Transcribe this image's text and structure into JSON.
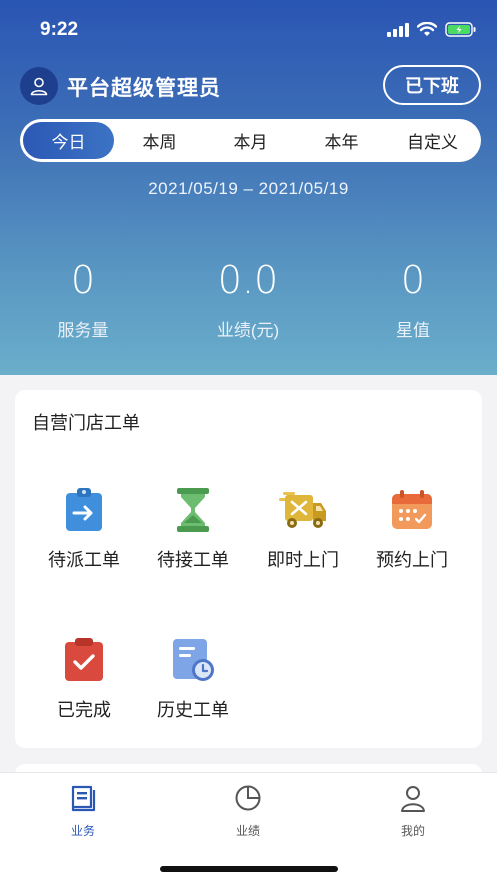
{
  "status": {
    "time": "9:22"
  },
  "header": {
    "admin_name": "平台超级管理员",
    "offduty_label": "已下班",
    "tabs": [
      "今日",
      "本周",
      "本月",
      "本年",
      "自定义"
    ],
    "date_range": "2021/05/19 – 2021/05/19"
  },
  "stats": [
    {
      "value": "0",
      "label": "服务量"
    },
    {
      "value": "0.0",
      "label": "业绩(元)"
    },
    {
      "value": "0",
      "label": "星值"
    }
  ],
  "card": {
    "title": "自营门店工单",
    "items": [
      {
        "label": "待派工单",
        "icon": "clipboard-arrow-icon",
        "color": "#3f8fdc"
      },
      {
        "label": "待接工单",
        "icon": "hourglass-icon",
        "color": "#5aac5e"
      },
      {
        "label": "即时上门",
        "icon": "delivery-truck-icon",
        "color": "#e0b63a"
      },
      {
        "label": "预约上门",
        "icon": "calendar-icon",
        "color": "#ef7f4a"
      },
      {
        "label": "已完成",
        "icon": "clipboard-check-icon",
        "color": "#d9493d"
      },
      {
        "label": "历史工单",
        "icon": "history-document-icon",
        "color": "#5b84d6"
      }
    ]
  },
  "tabbar": [
    {
      "label": "业务",
      "icon": "business-icon",
      "active": true
    },
    {
      "label": "业绩",
      "icon": "pie-chart-icon",
      "active": false
    },
    {
      "label": "我的",
      "icon": "profile-icon",
      "active": false
    }
  ],
  "colors": {
    "primary": "#2b58b5",
    "hero_top": "#2a55b4",
    "hero_bottom": "#6aaecb"
  }
}
